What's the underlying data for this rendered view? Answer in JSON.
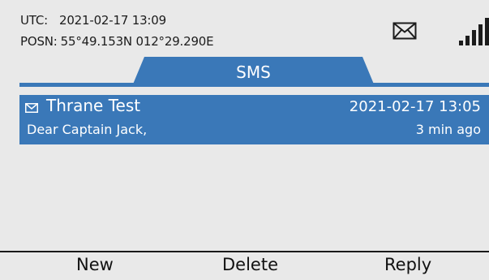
{
  "status": {
    "utc_label": "UTC:",
    "utc_value": "2021-02-17  13:09",
    "posn_label": "POSN:",
    "posn_value": "55°49.153N  012°29.290E",
    "message_indicator_icon": "envelope-icon",
    "signal_icon": "signal-strength-icon"
  },
  "tab": {
    "label": "SMS"
  },
  "messages": [
    {
      "icon": "envelope-icon",
      "sender": "Thrane Test",
      "datetime": "2021-02-17 13:05",
      "preview": "Dear Captain Jack,",
      "age": "3 min ago",
      "selected": true
    }
  ],
  "softkeys": {
    "left": "New",
    "center": "Delete",
    "right": "Reply"
  },
  "colors": {
    "accent": "#3a78b8",
    "background": "#e9e9e9",
    "text": "#1c1c1c",
    "selected_text": "#ffffff"
  }
}
